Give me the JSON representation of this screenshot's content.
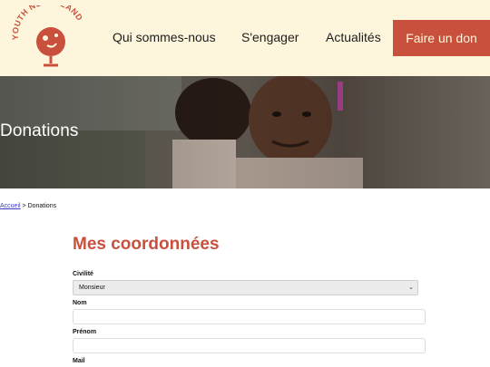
{
  "header": {
    "logo_text": "YOUTH NEVERLAND",
    "nav": [
      "Qui sommes-nous",
      "S'engager",
      "Actualités"
    ],
    "donate_label": "Faire un don"
  },
  "hero": {
    "title": "Donations"
  },
  "breadcrumb": {
    "home": "Accueil",
    "separator": " > ",
    "current": "Donations"
  },
  "form": {
    "title": "Mes coordonnées",
    "civilite_label": "Civilité",
    "civilite_value": "Monsieur",
    "nom_label": "Nom",
    "nom_value": "",
    "prenom_label": "Prénom",
    "prenom_value": "",
    "mail_label": "Mail"
  },
  "colors": {
    "accent": "#c9503d",
    "header_bg": "#fdf6dc"
  }
}
